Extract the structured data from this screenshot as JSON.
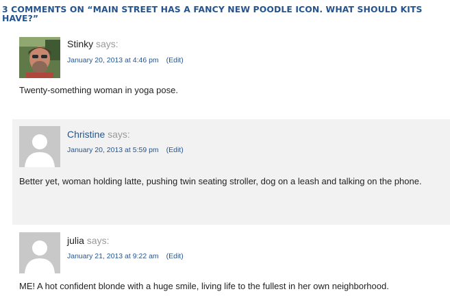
{
  "section": {
    "heading": "3 COMMENTS ON “MAIN STREET HAS A FANCY NEW POODLE ICON. WHAT SHOULD KITS HAVE?”"
  },
  "comments": [
    {
      "author": "Stinky",
      "says": "says:",
      "date": "January 20, 2013 at 4:46 pm",
      "edit": "(Edit)",
      "text": "Twenty-something woman in yoga pose."
    },
    {
      "author": "Christine",
      "says": "says:",
      "date": "January 20, 2013 at 5:59 pm",
      "edit": "(Edit)",
      "text": "Better yet, woman holding latte, pushing twin seating stroller, dog on a leash and talking on the phone."
    },
    {
      "author": "julia",
      "says": "says:",
      "date": "January 21, 2013 at 9:22 am",
      "edit": "(Edit)",
      "text": "ME! A hot confident blonde with a huge smile, living life to the fullest in her own neighborhood."
    }
  ],
  "colors": {
    "link": "#24548f",
    "says": "#999999",
    "alt_background": "#f2f2f2",
    "avatar_placeholder": "#c8c8c8"
  }
}
